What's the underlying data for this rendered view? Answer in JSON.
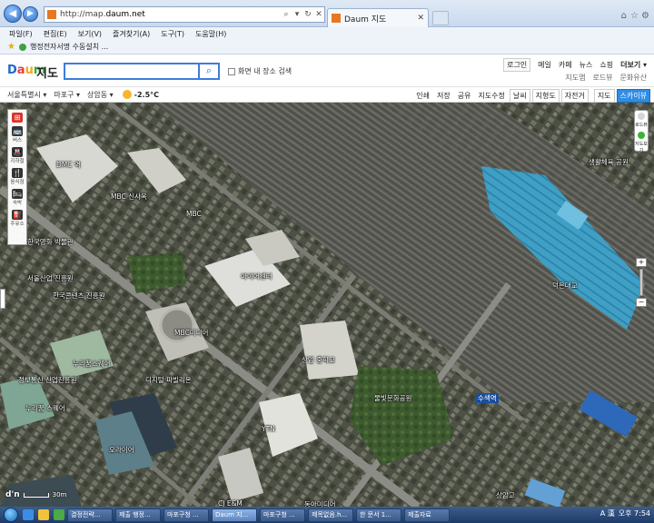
{
  "browser": {
    "url_prefix": "http://map.",
    "url_domain": "daum.net",
    "tab_label": "Daum 지도",
    "address_tools": [
      "⌕",
      "▾",
      "↻",
      "✕"
    ]
  },
  "menu": [
    "파일(F)",
    "편집(E)",
    "보기(V)",
    "즐겨찾기(A)",
    "도구(T)",
    "도움말(H)"
  ],
  "favorites": {
    "item": "행정전자서명 수동설치 ..."
  },
  "header": {
    "logo": [
      "D",
      "a",
      "u",
      "m"
    ],
    "service": "지도",
    "search_placeholder": "",
    "checkbox_label": "화면 내 장소 검색",
    "top_links": [
      "로그인",
      "메일",
      "카페",
      "뉴스",
      "쇼핑",
      "더보기 ▾"
    ],
    "sub_links": [
      "지도앱",
      "로드뷰",
      "문화유산"
    ]
  },
  "location_bar": {
    "city": "서울특별시 ▾",
    "district": "마포구 ▾",
    "dong": "상암동 ▾",
    "temperature": "-2.5°C",
    "tools": [
      "인쇄",
      "저장",
      "공유",
      "지도수정"
    ],
    "toggles": [
      "날씨",
      "지형도",
      "자전거"
    ],
    "view_map": "지도",
    "view_sky": "스카이뷰"
  },
  "left_tools": [
    {
      "label": "",
      "icon": "⊞"
    },
    {
      "label": "버스",
      "icon": "🚌"
    },
    {
      "label": "지하철",
      "icon": "🚇"
    },
    {
      "label": "음식점",
      "icon": "🍴"
    },
    {
      "label": "숙박",
      "icon": "🛏"
    },
    {
      "label": "주유소",
      "icon": "⛽"
    }
  ],
  "compass": {
    "top": "로드뷰",
    "bottom": "지도보기"
  },
  "map_labels": [
    {
      "text": "DMC 역",
      "blue": false
    },
    {
      "text": "MBC 신사옥",
      "blue": false
    },
    {
      "text": "MBC",
      "blue": false
    },
    {
      "text": "한국영화 박물관",
      "blue": false
    },
    {
      "text": "서울산업 진흥원",
      "blue": false
    },
    {
      "text": "한국콘텐츠 진흥원",
      "blue": false
    },
    {
      "text": "누리꿈스퀘어",
      "blue": false
    },
    {
      "text": "디지털 파빌리온",
      "blue": false
    },
    {
      "text": "정보통신 산업진흥원",
      "blue": false
    },
    {
      "text": "누리꿈 스퀘어",
      "blue": false
    },
    {
      "text": "아이어센터",
      "blue": false
    },
    {
      "text": "MBC미디어",
      "blue": false
    },
    {
      "text": "오라이어",
      "blue": false
    },
    {
      "text": "YTN",
      "blue": false
    },
    {
      "text": "상암 중학교",
      "blue": false
    },
    {
      "text": "물빛문화공원",
      "blue": false
    },
    {
      "text": "수색역",
      "blue": true
    },
    {
      "text": "덕은대교",
      "blue": false
    },
    {
      "text": "생활체육 공원",
      "blue": false
    },
    {
      "text": "동아미디어",
      "blue": false
    },
    {
      "text": "CJ E&M",
      "blue": false
    },
    {
      "text": "상암고",
      "blue": false
    }
  ],
  "scale": {
    "logo": "d'n",
    "text": "30m"
  },
  "taskbar": {
    "buttons": [
      "결정전략...",
      "제출 행정...",
      "마포구청 ...",
      "Daum 지...",
      "마포구청 ...",
      "제목없음.h...",
      "한 문서 1...",
      "제출자료"
    ],
    "active_index": 3,
    "tray_ime": "A 漢",
    "clock": "오후 7:54"
  }
}
